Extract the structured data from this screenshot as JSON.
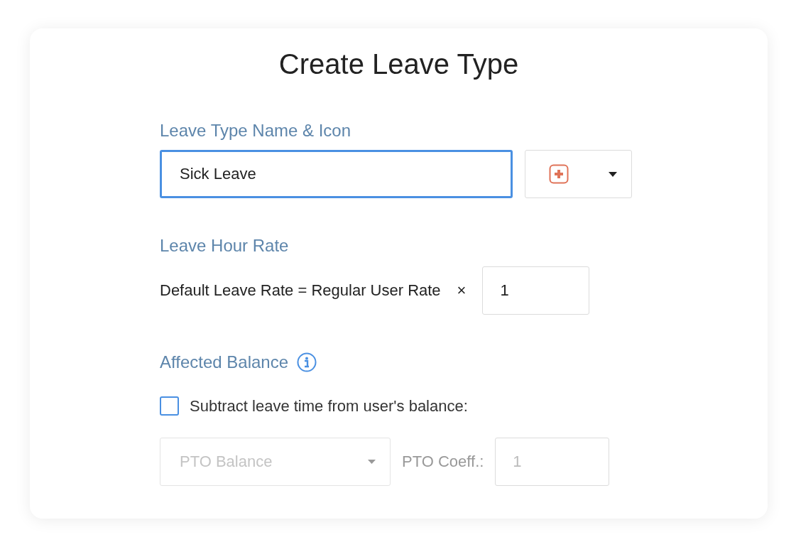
{
  "title": "Create Leave Type",
  "name_section": {
    "label": "Leave Type Name & Icon",
    "name_value": "Sick Leave",
    "focused": true
  },
  "rate_section": {
    "label": "Leave Hour Rate",
    "formula": "Default Leave Rate = Regular User Rate",
    "times": "×",
    "rate_value": "1"
  },
  "balance_section": {
    "label": "Affected Balance",
    "checkbox": {
      "label": "Subtract leave time from user's balance:",
      "checked": false
    },
    "balance_select": {
      "value": "PTO Balance",
      "disabled": true
    },
    "coeff_label": "PTO Coeff.:",
    "coeff_value": "1"
  }
}
